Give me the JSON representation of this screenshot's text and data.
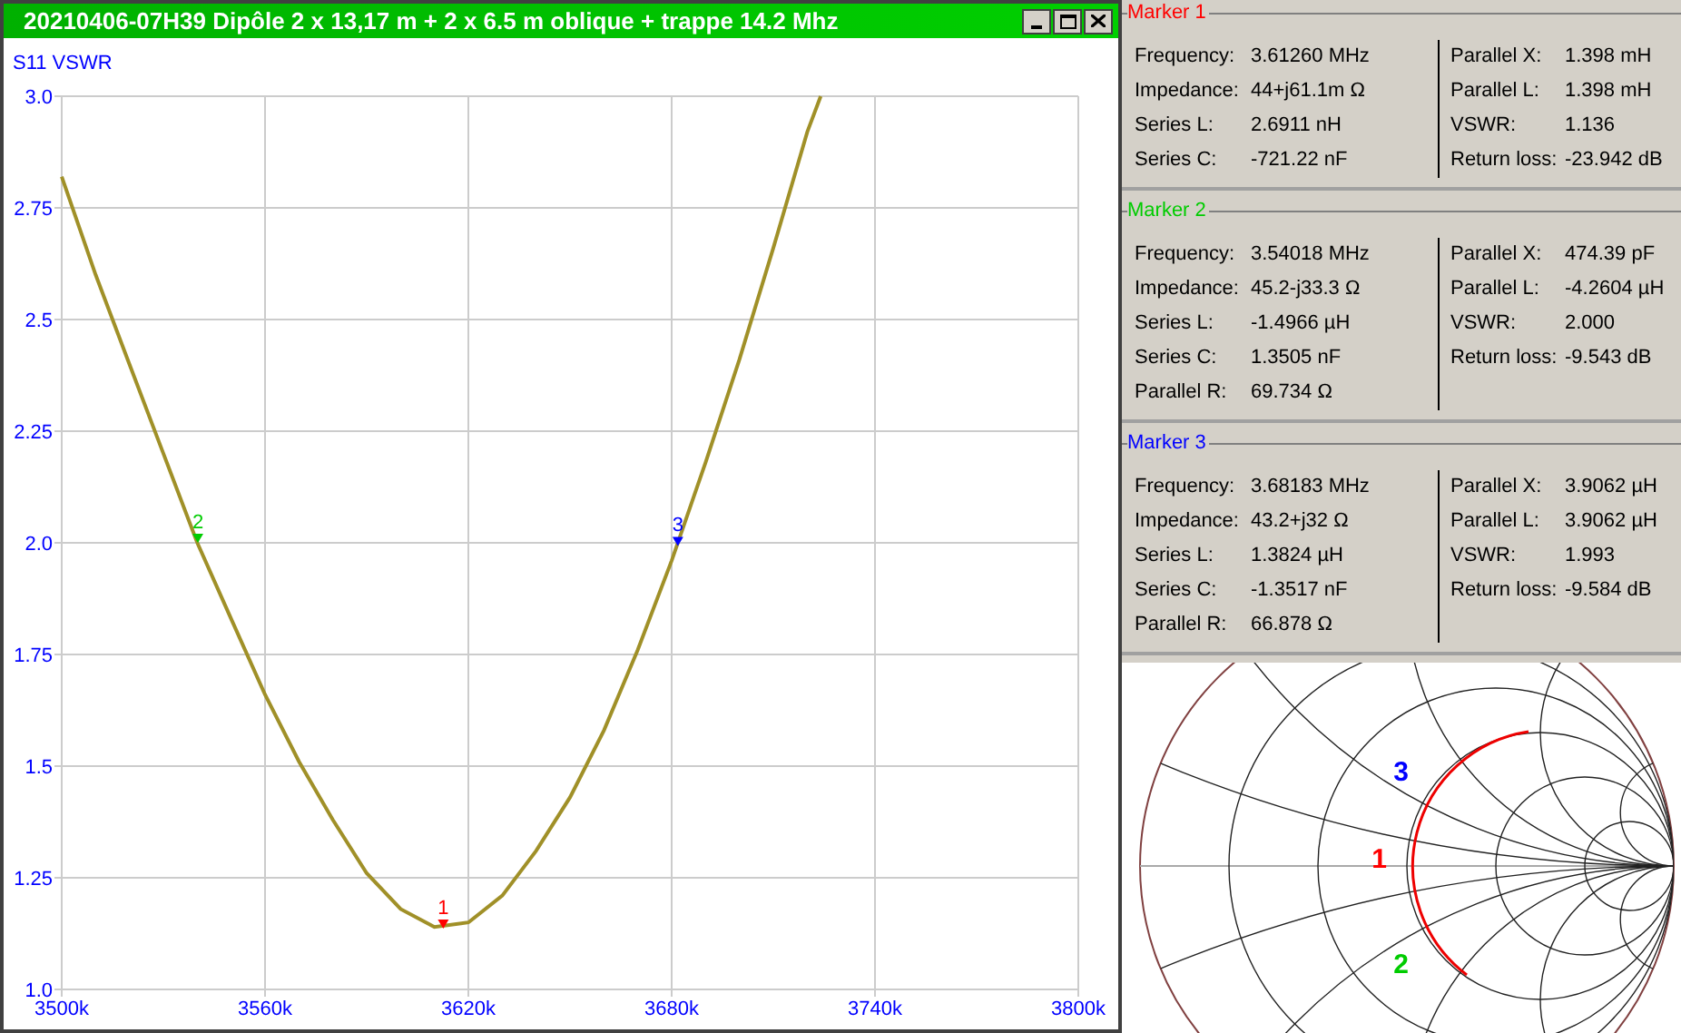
{
  "window": {
    "title": "20210406-07H39 Dipôle 2 x 13,17 m + 2 x 6.5 m oblique + trappe 14.2 Mhz"
  },
  "plot": {
    "label": "S11 VSWR",
    "chart_data": {
      "type": "line",
      "x": [
        3500,
        3510,
        3520,
        3530,
        3540,
        3550,
        3560,
        3570,
        3580,
        3590,
        3600,
        3610,
        3620,
        3630,
        3640,
        3650,
        3660,
        3670,
        3680,
        3690,
        3700,
        3710,
        3720,
        3724
      ],
      "grid": true,
      "series": [
        {
          "color": "#a09028",
          "values": [
            2.82,
            2.6,
            2.4,
            2.2,
            2.0,
            1.83,
            1.66,
            1.51,
            1.38,
            1.26,
            1.18,
            1.14,
            1.15,
            1.21,
            1.31,
            1.43,
            1.58,
            1.76,
            1.96,
            2.18,
            2.41,
            2.66,
            2.92,
            3.0
          ]
        }
      ],
      "xlim": [
        3500,
        3800
      ],
      "ylim": [
        1,
        3
      ],
      "xticks": [
        {
          "value": 3500,
          "label": "3500k"
        },
        {
          "value": 3560,
          "label": "3560k"
        },
        {
          "value": 3620,
          "label": "3620k"
        },
        {
          "value": 3680,
          "label": "3680k"
        },
        {
          "value": 3740,
          "label": "3740k"
        },
        {
          "value": 3800,
          "label": "3800k"
        }
      ],
      "yticks": [
        {
          "value": 1,
          "label": "1.0"
        },
        {
          "value": 1.25,
          "label": "1.25"
        },
        {
          "value": 1.5,
          "label": "1.5"
        },
        {
          "value": 1.75,
          "label": "1.75"
        },
        {
          "value": 2,
          "label": "2.0"
        },
        {
          "value": 2.25,
          "label": "2.25"
        },
        {
          "value": 2.5,
          "label": "2.5"
        },
        {
          "value": 2.75,
          "label": "2.75"
        },
        {
          "value": 3,
          "label": "3.0"
        }
      ],
      "annotations": [
        {
          "x": 3612.6,
          "y": 1.136,
          "text": "1"
        },
        {
          "x": 3540.18,
          "y": 2.0,
          "text": "2"
        },
        {
          "x": 3681.83,
          "y": 1.993,
          "text": "3"
        }
      ]
    },
    "marker_flags": [
      {
        "color": "#ff0000"
      },
      {
        "color": "#00cc00"
      },
      {
        "color": "#0000ff"
      }
    ]
  },
  "markers": [
    {
      "title": "Marker 1",
      "color": "#ff0000",
      "left": [
        {
          "label": "Frequency:",
          "value": "3.61260 MHz"
        },
        {
          "label": "Impedance:",
          "value": "44+j61.1m Ω"
        },
        {
          "label": "Series L:",
          "value": "2.6911 nH"
        },
        {
          "label": "Series C:",
          "value": "-721.22 nF"
        }
      ],
      "right": [
        {
          "label": "Parallel X:",
          "value": "1.398 mH"
        },
        {
          "label": "Parallel L:",
          "value": "1.398 mH"
        },
        {
          "label": "VSWR:",
          "value": "1.136"
        },
        {
          "label": "Return loss:",
          "value": "-23.942 dB"
        }
      ]
    },
    {
      "title": "Marker 2",
      "color": "#00cc00",
      "left": [
        {
          "label": "Frequency:",
          "value": "3.54018 MHz"
        },
        {
          "label": "Impedance:",
          "value": "45.2-j33.3 Ω"
        },
        {
          "label": "Series L:",
          "value": "-1.4966 µH"
        },
        {
          "label": "Series C:",
          "value": "1.3505 nF"
        },
        {
          "label": "Parallel R:",
          "value": "69.734 Ω"
        }
      ],
      "right": [
        {
          "label": "Parallel X:",
          "value": "474.39 pF"
        },
        {
          "label": "Parallel L:",
          "value": "-4.2604 µH"
        },
        {
          "label": "VSWR:",
          "value": "2.000"
        },
        {
          "label": "Return loss:",
          "value": "-9.543 dB"
        }
      ]
    },
    {
      "title": "Marker 3",
      "color": "#0000ff",
      "left": [
        {
          "label": "Frequency:",
          "value": "3.68183 MHz"
        },
        {
          "label": "Impedance:",
          "value": "43.2+j32 Ω"
        },
        {
          "label": "Series L:",
          "value": "1.3824 µH"
        },
        {
          "label": "Series C:",
          "value": "-1.3517 nF"
        },
        {
          "label": "Parallel R:",
          "value": "66.878 Ω"
        }
      ],
      "right": [
        {
          "label": "Parallel X:",
          "value": "3.9062 µH"
        },
        {
          "label": "Parallel L:",
          "value": "3.9062 µH"
        },
        {
          "label": "VSWR:",
          "value": "1.993"
        },
        {
          "label": "Return loss:",
          "value": "-9.584 dB"
        }
      ]
    }
  ],
  "smith": {
    "labels": [
      {
        "text": "3",
        "color": "#0000ff"
      },
      {
        "text": "1",
        "color": "#ff0000"
      },
      {
        "text": "2",
        "color": "#00cc00"
      }
    ]
  }
}
